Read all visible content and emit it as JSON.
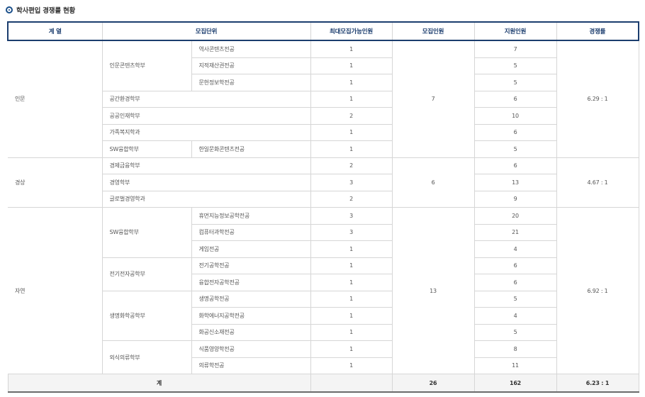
{
  "title": "학사편입 경쟁률 현황",
  "headers": {
    "field": "계 열",
    "unit": "모집단위",
    "max_capacity": "최대모집가능인원",
    "recruit": "모집인원",
    "applicants": "지원인원",
    "ratio": "경쟁률"
  },
  "groups": [
    {
      "field": "인문",
      "recruit": "7",
      "ratio": "6.29 : 1",
      "rows": [
        {
          "dept": "인문콘텐츠학부",
          "major": "역사콘텐츠전공",
          "max": "1",
          "applicants": "7"
        },
        {
          "dept": "인문콘텐츠학부",
          "major": "지적재산권전공",
          "max": "1",
          "applicants": "5"
        },
        {
          "dept": "인문콘텐츠학부",
          "major": "문헌정보학전공",
          "max": "1",
          "applicants": "5"
        },
        {
          "dept": "공간환경학부",
          "major": "",
          "max": "1",
          "applicants": "6"
        },
        {
          "dept": "공공인재학부",
          "major": "",
          "max": "2",
          "applicants": "10"
        },
        {
          "dept": "가족복지학과",
          "major": "",
          "max": "1",
          "applicants": "6"
        },
        {
          "dept": "SW융합학부",
          "major": "한일문화콘텐츠전공",
          "max": "1",
          "applicants": "5"
        }
      ]
    },
    {
      "field": "경상",
      "recruit": "6",
      "ratio": "4.67 : 1",
      "rows": [
        {
          "dept": "경제금융학부",
          "major": "",
          "max": "2",
          "applicants": "6"
        },
        {
          "dept": "경영학부",
          "major": "",
          "max": "3",
          "applicants": "13"
        },
        {
          "dept": "글로벌경영학과",
          "major": "",
          "max": "2",
          "applicants": "9"
        }
      ]
    },
    {
      "field": "자연",
      "recruit": "13",
      "ratio": "6.92 : 1",
      "rows": [
        {
          "dept": "SW융합학부",
          "major": "휴먼지능정보공학전공",
          "max": "3",
          "applicants": "20"
        },
        {
          "dept": "SW융합학부",
          "major": "컴퓨터과학전공",
          "max": "3",
          "applicants": "21"
        },
        {
          "dept": "SW융합학부",
          "major": "게임전공",
          "max": "1",
          "applicants": "4"
        },
        {
          "dept": "전기전자공학부",
          "major": "전기공학전공",
          "max": "1",
          "applicants": "6"
        },
        {
          "dept": "전기전자공학부",
          "major": "융합전자공학전공",
          "max": "1",
          "applicants": "6"
        },
        {
          "dept": "생명화학공학부",
          "major": "생명공학전공",
          "max": "1",
          "applicants": "5"
        },
        {
          "dept": "생명화학공학부",
          "major": "화학에너지공학전공",
          "max": "1",
          "applicants": "4"
        },
        {
          "dept": "생명화학공학부",
          "major": "화공신소재전공",
          "max": "1",
          "applicants": "5"
        },
        {
          "dept": "외식의류학부",
          "major": "식품영양학전공",
          "max": "1",
          "applicants": "8"
        },
        {
          "dept": "외식의류학부",
          "major": "의류학전공",
          "max": "1",
          "applicants": "11"
        }
      ]
    }
  ],
  "total": {
    "label": "계",
    "max": "",
    "recruit": "26",
    "applicants": "162",
    "ratio": "6.23 : 1"
  }
}
